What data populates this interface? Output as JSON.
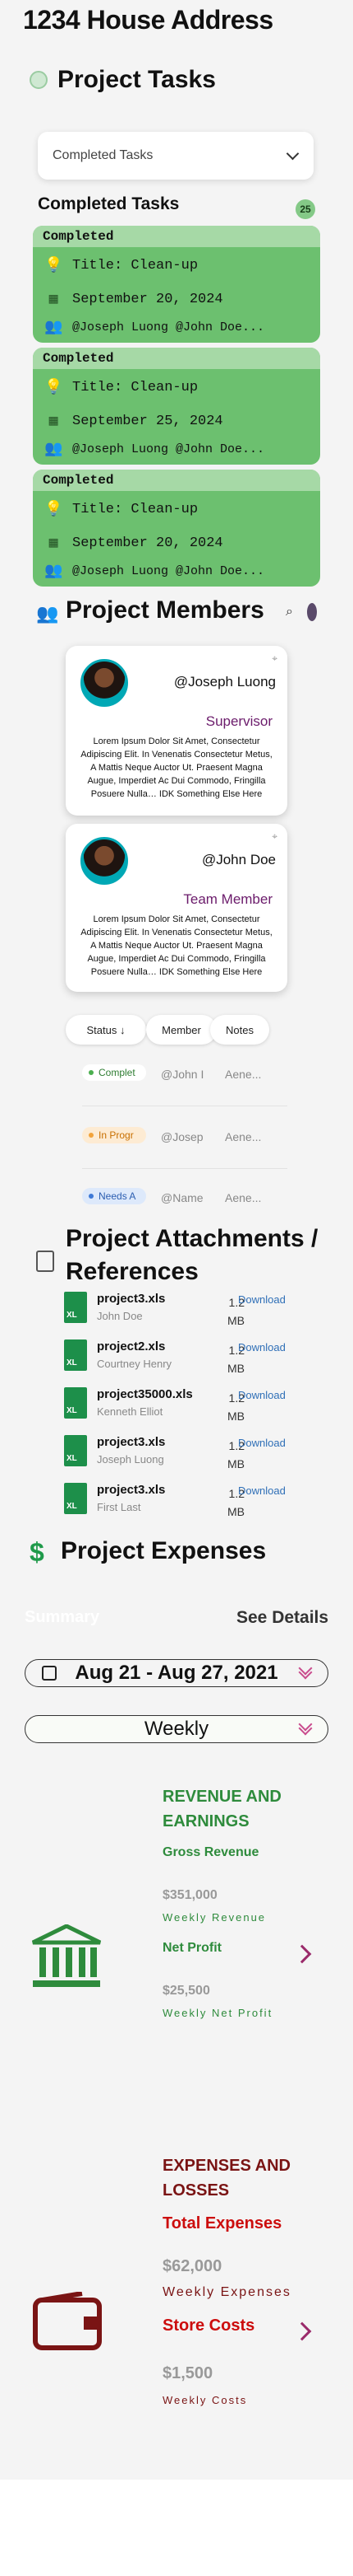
{
  "page": {
    "title": "1234 House Address"
  },
  "tasks_section": {
    "title": "Project Tasks",
    "dropdown_value": "Completed Tasks",
    "list_title": "Completed Tasks",
    "count": "25",
    "cards": [
      {
        "status": "Completed",
        "title": "Title: Clean-up",
        "date": "September 20, 2024",
        "members": "@Joseph Luong @John Doe..."
      },
      {
        "status": "Completed",
        "title": "Title: Clean-up",
        "date": "September 25, 2024",
        "members": "@Joseph Luong @John Doe..."
      },
      {
        "status": "Completed",
        "title": "Title: Clean-up",
        "date": "September 20, 2024",
        "members": "@Joseph Luong @John Doe..."
      }
    ]
  },
  "members_section": {
    "title": "Project Members",
    "members": [
      {
        "name": "@Joseph Luong",
        "role": "Supervisor",
        "desc": "Lorem Ipsum Dolor Sit Amet, Consectetur Adipiscing Elit. In Venenatis Consectetur Metus, A Mattis Neque Auctor Ut. Praesent Magna Augue, Imperdiet Ac Dui Commodo, Fringilla Posuere Nulla… IDK Something Else Here"
      },
      {
        "name": "@John Doe",
        "role": "Team Member",
        "desc": "Lorem Ipsum Dolor Sit Amet, Consectetur Adipiscing Elit. In Venenatis Consectetur Metus, A Mattis Neque Auctor Ut. Praesent Magna Augue, Imperdiet Ac Dui Commodo, Fringilla Posuere Nulla… IDK Something Else Here"
      }
    ],
    "table": {
      "headers": {
        "status": "Status ↓",
        "member": "Member",
        "notes": "Notes"
      },
      "rows": [
        {
          "status": "Complet",
          "member": "@John I",
          "notes": "Aene..."
        },
        {
          "status": "In Progr",
          "member": "@Josep",
          "notes": "Aene..."
        },
        {
          "status": "Needs A",
          "member": "@Name",
          "notes": "Aene..."
        }
      ]
    }
  },
  "attachments_section": {
    "title_line1": "Project Attachments /",
    "title_line2": "References",
    "files": [
      {
        "name": "project3.xls",
        "user": "John Doe",
        "size_num": "1.2",
        "size_unit": "MB",
        "action": "Download"
      },
      {
        "name": "project2.xls",
        "user": "Courtney Henry",
        "size_num": "1.2",
        "size_unit": "MB",
        "action": "Download"
      },
      {
        "name": "project35000.xls",
        "user": "Kenneth Elliot",
        "size_num": "1.2",
        "size_unit": "MB",
        "action": "Download"
      },
      {
        "name": "project3.xls",
        "user": "Joseph Luong",
        "size_num": "1.2",
        "size_unit": "MB",
        "action": "Download"
      },
      {
        "name": "project3.xls",
        "user": "First Last",
        "size_num": "1.2",
        "size_unit": "MB",
        "action": "Download"
      }
    ]
  },
  "expenses_section": {
    "title": "Project Expenses",
    "summary_label": "Summary",
    "see_details": "See Details",
    "date_range": "Aug 21 - Aug 27, 2021",
    "period": "Weekly",
    "revenue": {
      "heading": "REVENUE AND EARNINGS",
      "gross_label": "Gross Revenue",
      "gross_value": "$351,000",
      "gross_caption": "Weekly Revenue",
      "net_label": "Net Profit",
      "net_value": "$25,500",
      "net_caption": "Weekly Net Profit"
    },
    "expenses": {
      "heading": "EXPENSES AND LOSSES",
      "total_label": "Total Expenses",
      "total_value": "$62,000",
      "total_caption": "Weekly Expenses",
      "store_label": "Store Costs",
      "store_value": "$1,500",
      "store_caption": "Weekly Costs"
    }
  },
  "colors": {
    "green": "#6cc06f",
    "revenue_text": "#2e8b3c",
    "expense_text": "#7a1414",
    "chev": "#9a2a6a"
  }
}
